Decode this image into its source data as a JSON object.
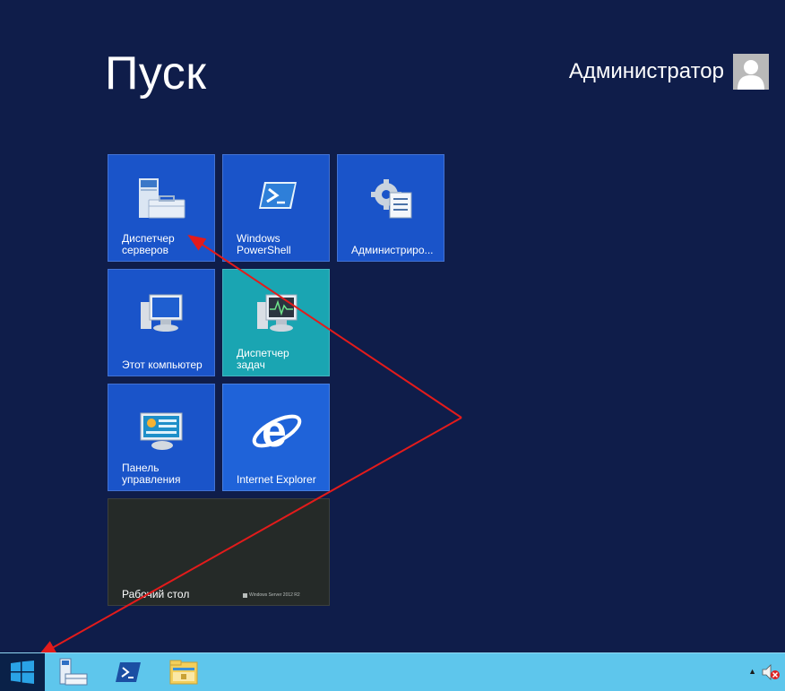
{
  "header": {
    "title": "Пуск",
    "user_name": "Администратор"
  },
  "tiles": {
    "server_manager": "Диспетчер\nсерверов",
    "powershell": "Windows\nPowerShell",
    "admin_tools": "Администриро...",
    "this_pc": "Этот компьютер",
    "task_manager": "Диспетчер\nзадач",
    "control_panel": "Панель\nуправления",
    "ie": "Internet Explorer",
    "desktop": "Рабочий стол",
    "desktop_brand": "Windows Server 2012 R2"
  },
  "colors": {
    "background": "#0f1d4a",
    "tile_blue": "#1a54c9",
    "tile_teal": "#1aa5b2",
    "tile_desktop": "#252a28",
    "taskbar": "#5ec6ec",
    "annotation": "#e31b1b"
  },
  "taskbar": {
    "icons": [
      "windows-logo-icon",
      "server-manager-icon",
      "powershell-icon",
      "file-explorer-icon"
    ],
    "tray": [
      "show-hidden-icons-arrow",
      "speaker-muted-icon"
    ]
  }
}
